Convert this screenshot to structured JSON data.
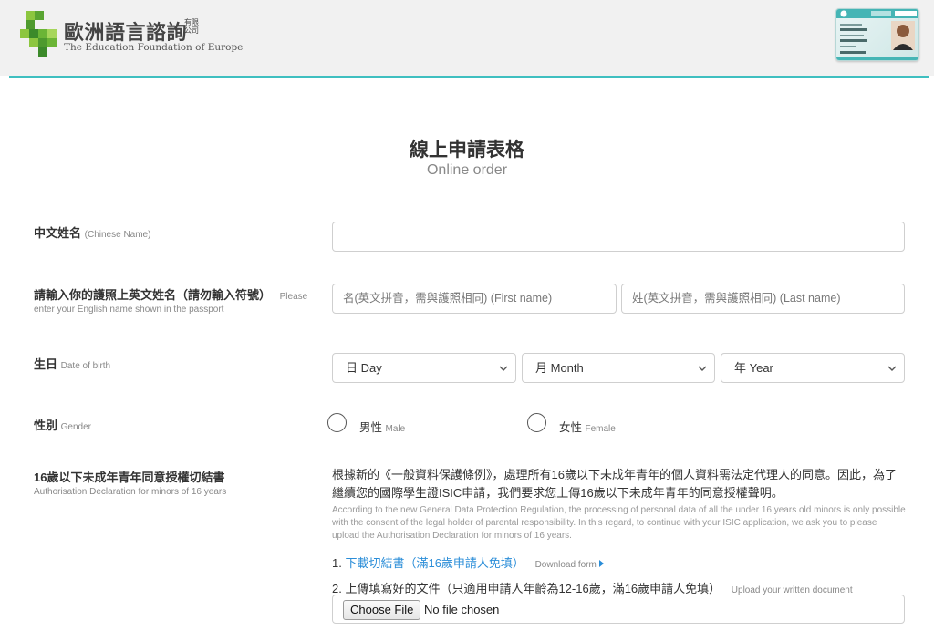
{
  "header": {
    "logo_cn": "歐洲語言諮詢",
    "logo_cn_small": "有限公司",
    "logo_en": "The Education Foundation of Europe",
    "accent_color": "#3fbfc0"
  },
  "page": {
    "title_cn": "線上申請表格",
    "title_en": "Online order"
  },
  "form": {
    "chinese_name": {
      "label": "中文姓名",
      "sub": "(Chinese Name)",
      "value": ""
    },
    "english_name": {
      "label": "請輸入你的護照上英文姓名（請勿輸入符號）",
      "sub": "Please",
      "sub2": "enter your English name shown in the passport",
      "first_placeholder": "名(英文拼音，需與護照相同) (First name)",
      "last_placeholder": "姓(英文拼音，需與護照相同) (Last name)"
    },
    "birth": {
      "label": "生日",
      "sub": "Date of birth",
      "day": "日 Day",
      "month": "月 Month",
      "year": "年 Year"
    },
    "gender": {
      "label": "性別",
      "sub": "Gender",
      "male": "男性",
      "male_sub": "Male",
      "female": "女性",
      "female_sub": "Female"
    },
    "declaration": {
      "label": "16歲以下未成年青年同意授權切結書",
      "sub": "Authorisation Declaration for minors of 16 years",
      "text_cn": "根據新的《一般資料保護條例》，處理所有16歲以下未成年青年的個人資料需法定代理人的同意。因此，為了繼續您的國際學生證ISIC申請，我們要求您上傳16歲以下未成年青年的同意授權聲明。",
      "text_en": "According to the new General Data Protection Regulation, the processing of personal data of all the under 16 years old minors is only possible with the consent of the legal holder of parental responsibility. In this regard, to continue with your ISIC application, we ask you to please upload the Authorisation Declaration for minors of 16 years.",
      "step1_num": "1.",
      "step1_link": "下載切結書（滿16歲申請人免填）",
      "step1_sub": "Download form",
      "step2_text": "2. 上傳填寫好的文件（只適用申請人年齡為12-16歲，滿16歲申請人免填）",
      "step2_sub": "Upload your written document",
      "file_button": "Choose File",
      "file_status": "No file chosen"
    }
  }
}
